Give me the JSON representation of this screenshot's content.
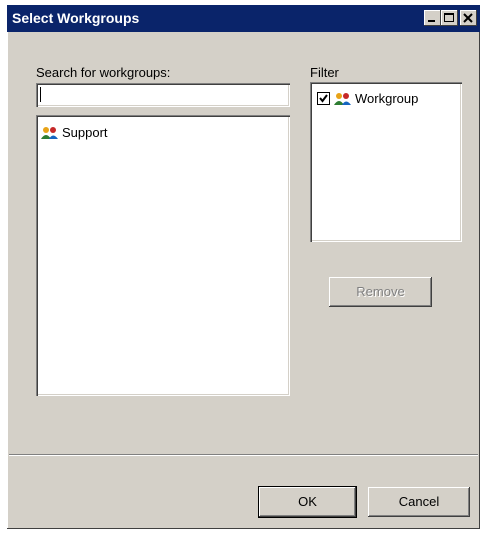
{
  "window": {
    "title": "Select Workgroups"
  },
  "search": {
    "label": "Search for workgroups:",
    "value": ""
  },
  "results": {
    "items": [
      {
        "label": "Support",
        "icon": "workgroup-icon"
      }
    ]
  },
  "filter": {
    "label": "Filter",
    "items": [
      {
        "label": "Workgroup",
        "checked": true,
        "icon": "workgroup-icon"
      }
    ]
  },
  "buttons": {
    "remove": "Remove",
    "ok": "OK",
    "cancel": "Cancel"
  },
  "colors": {
    "titlebar": "#0a246a",
    "dialog_bg": "#d4d0c8"
  }
}
